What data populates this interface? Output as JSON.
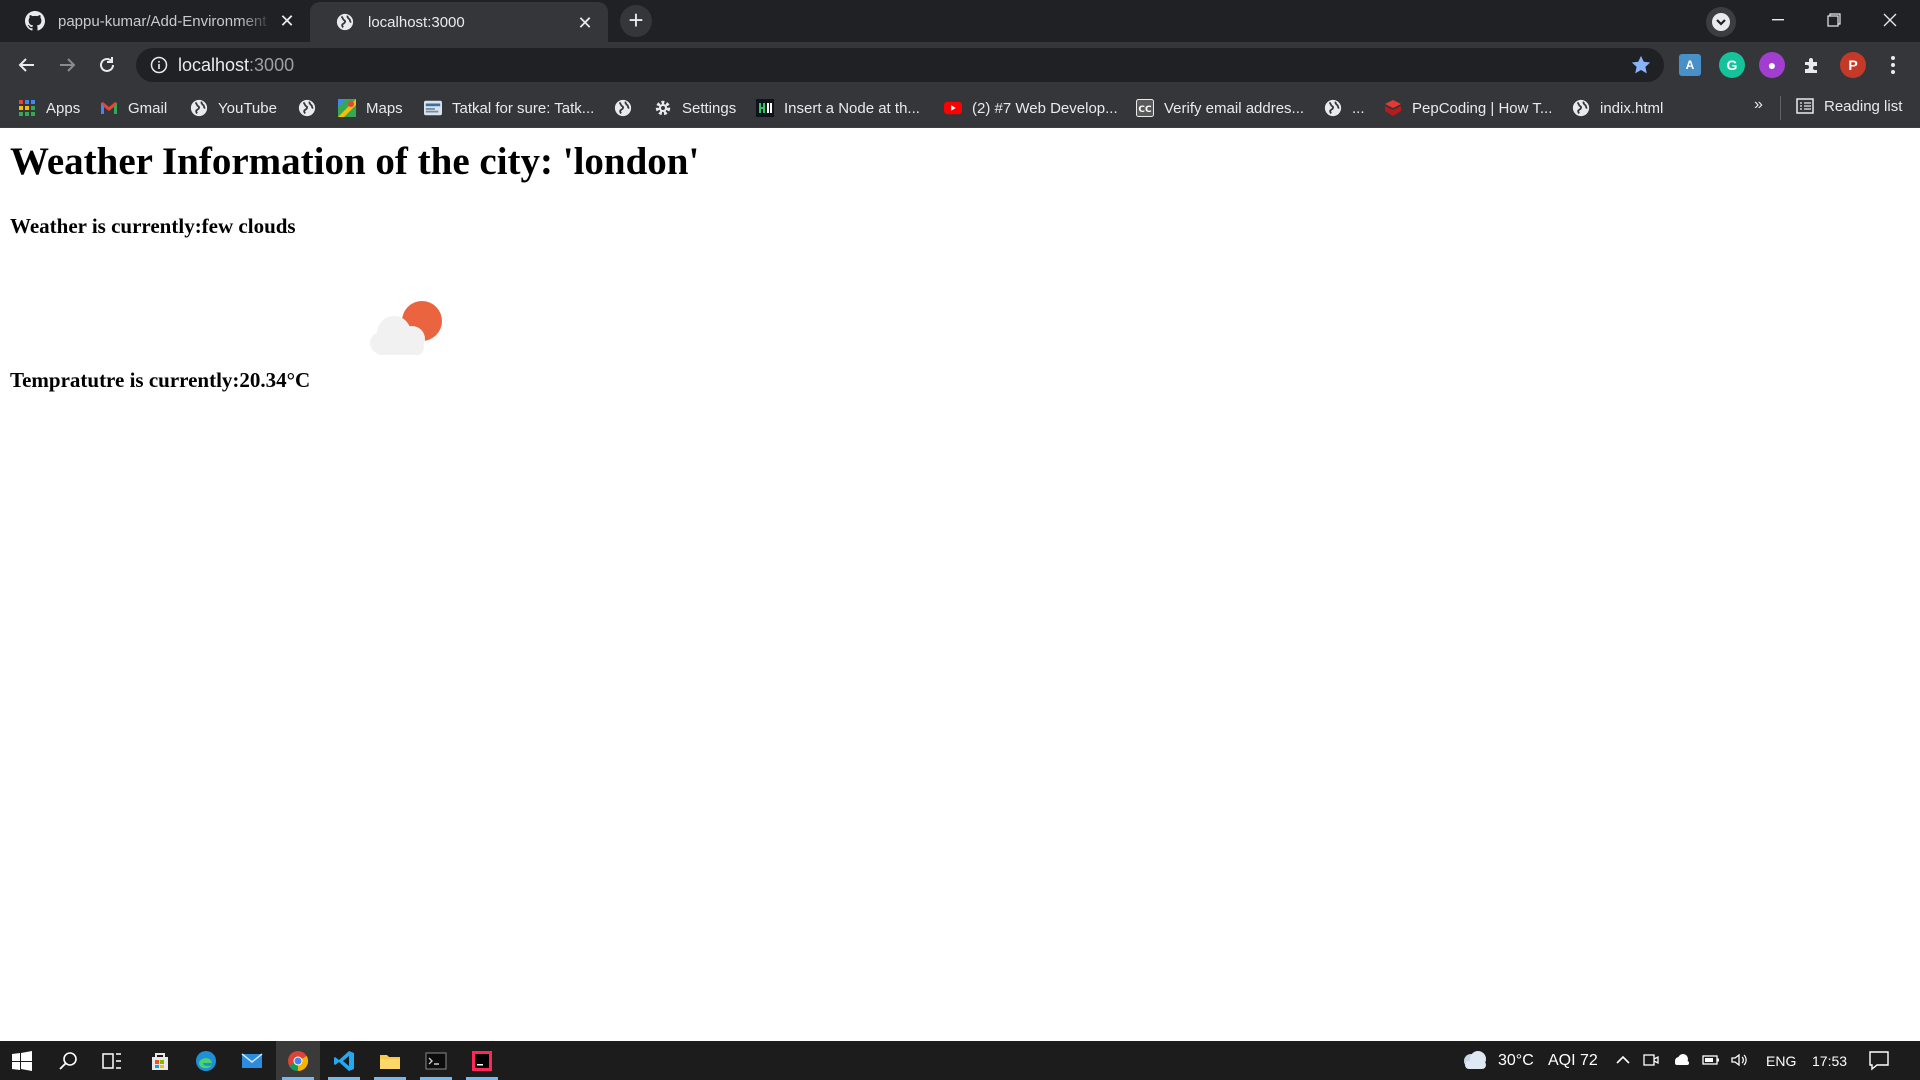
{
  "browser": {
    "tabs": [
      {
        "title": "pappu-kumar/Add-Environment",
        "icon": "github-icon",
        "active": false
      },
      {
        "title": "localhost:3000",
        "icon": "globe-icon",
        "active": true
      }
    ],
    "address": {
      "host": "localhost",
      "port": ":3000"
    },
    "bookmarks": [
      {
        "label": "Apps",
        "icon": "apps-grid-icon"
      },
      {
        "label": "Gmail",
        "icon": "gmail-icon"
      },
      {
        "label": "YouTube",
        "icon": "globe-icon"
      },
      {
        "label": "",
        "icon": "globe-icon"
      },
      {
        "label": "Maps",
        "icon": "maps-icon"
      },
      {
        "label": "Tatkal for sure: Tatk...",
        "icon": "tatkal-icon"
      },
      {
        "label": "",
        "icon": "globe-icon"
      },
      {
        "label": "Settings",
        "icon": "gear-icon"
      },
      {
        "label": "Insert a Node at th...",
        "icon": "hackerrank-icon"
      },
      {
        "label": "(2) #7 Web Develop...",
        "icon": "youtube-icon"
      },
      {
        "label": "Verify email addres...",
        "icon": "cc-icon"
      },
      {
        "label": "...",
        "icon": "globe-icon"
      },
      {
        "label": "PepCoding | How T...",
        "icon": "pepcoding-icon"
      },
      {
        "label": "indix.html",
        "icon": "globe-icon"
      }
    ],
    "bookmarks_overflow": "»",
    "reading_list": "Reading list",
    "profile_initial": "P"
  },
  "page": {
    "heading": "Weather Information of the city: 'london'",
    "weather_line": "Weather is currently:few clouds",
    "temperature_line": "Tempratutre is currently:20.34°C",
    "weather_icon": "few-clouds-day-icon"
  },
  "taskbar": {
    "weather_temp": "30°C",
    "aqi": "AQI 72",
    "language": "ENG",
    "time": "17:53"
  },
  "colors": {
    "tab_strip": "#202124",
    "toolbar": "#35363a",
    "sun": "#e9643f",
    "cloud": "#f1f1f1",
    "taskbar": "#1c1c1c"
  }
}
